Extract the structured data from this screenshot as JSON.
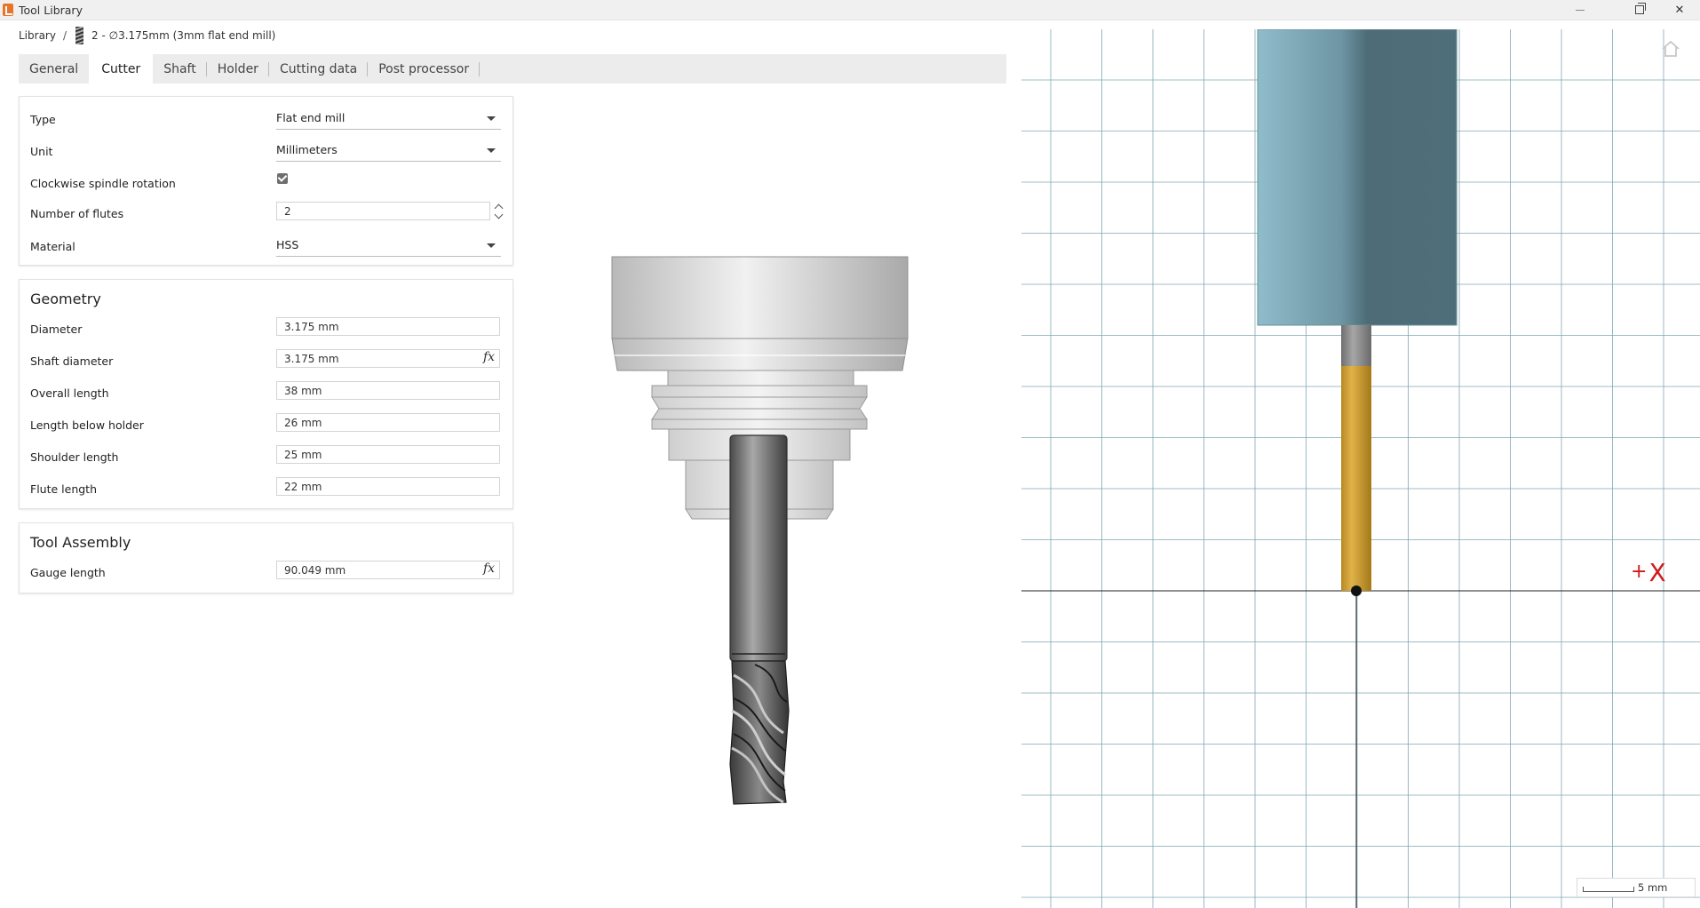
{
  "window": {
    "title": "Tool Library"
  },
  "breadcrumb": {
    "root": "Library",
    "separator": "/",
    "current": "2 - ∅3.175mm (3mm flat end mill)"
  },
  "tabs": [
    "General",
    "Cutter",
    "Shaft",
    "Holder",
    "Cutting data",
    "Post processor"
  ],
  "active_tab": "Cutter",
  "cutter": {
    "type_label": "Type",
    "type_value": "Flat end mill",
    "unit_label": "Unit",
    "unit_value": "Millimeters",
    "clockwise_label": "Clockwise spindle rotation",
    "clockwise_checked": true,
    "flutes_label": "Number of flutes",
    "flutes_value": "2",
    "material_label": "Material",
    "material_value": "HSS"
  },
  "geometry": {
    "title": "Geometry",
    "diameter_label": "Diameter",
    "diameter_value": "3.175 mm",
    "shaft_diameter_label": "Shaft diameter",
    "shaft_diameter_value": "3.175 mm",
    "overall_length_label": "Overall length",
    "overall_length_value": "38 mm",
    "length_below_holder_label": "Length below holder",
    "length_below_holder_value": "26 mm",
    "shoulder_length_label": "Shoulder length",
    "shoulder_length_value": "25 mm",
    "flute_length_label": "Flute length",
    "flute_length_value": "22 mm",
    "fx_label": "fx"
  },
  "assembly": {
    "title": "Tool Assembly",
    "gauge_length_label": "Gauge length",
    "gauge_length_value": "90.049 mm",
    "fx_label": "fx"
  },
  "view2d": {
    "axis_label": "X",
    "axis_sign": "+",
    "scale_text": "5 mm"
  },
  "colors": {
    "holder_blue_light": "#8fbccb",
    "holder_blue_dark": "#4d6c78",
    "flute_gold": "#d6a43a",
    "grid_line": "#7fa9b4",
    "axis_red": "#d11a1a",
    "tab_bar": "#ececec"
  },
  "icons": {
    "home": "home-icon",
    "fx": "function-icon",
    "dropdown": "chevron-down-icon"
  }
}
